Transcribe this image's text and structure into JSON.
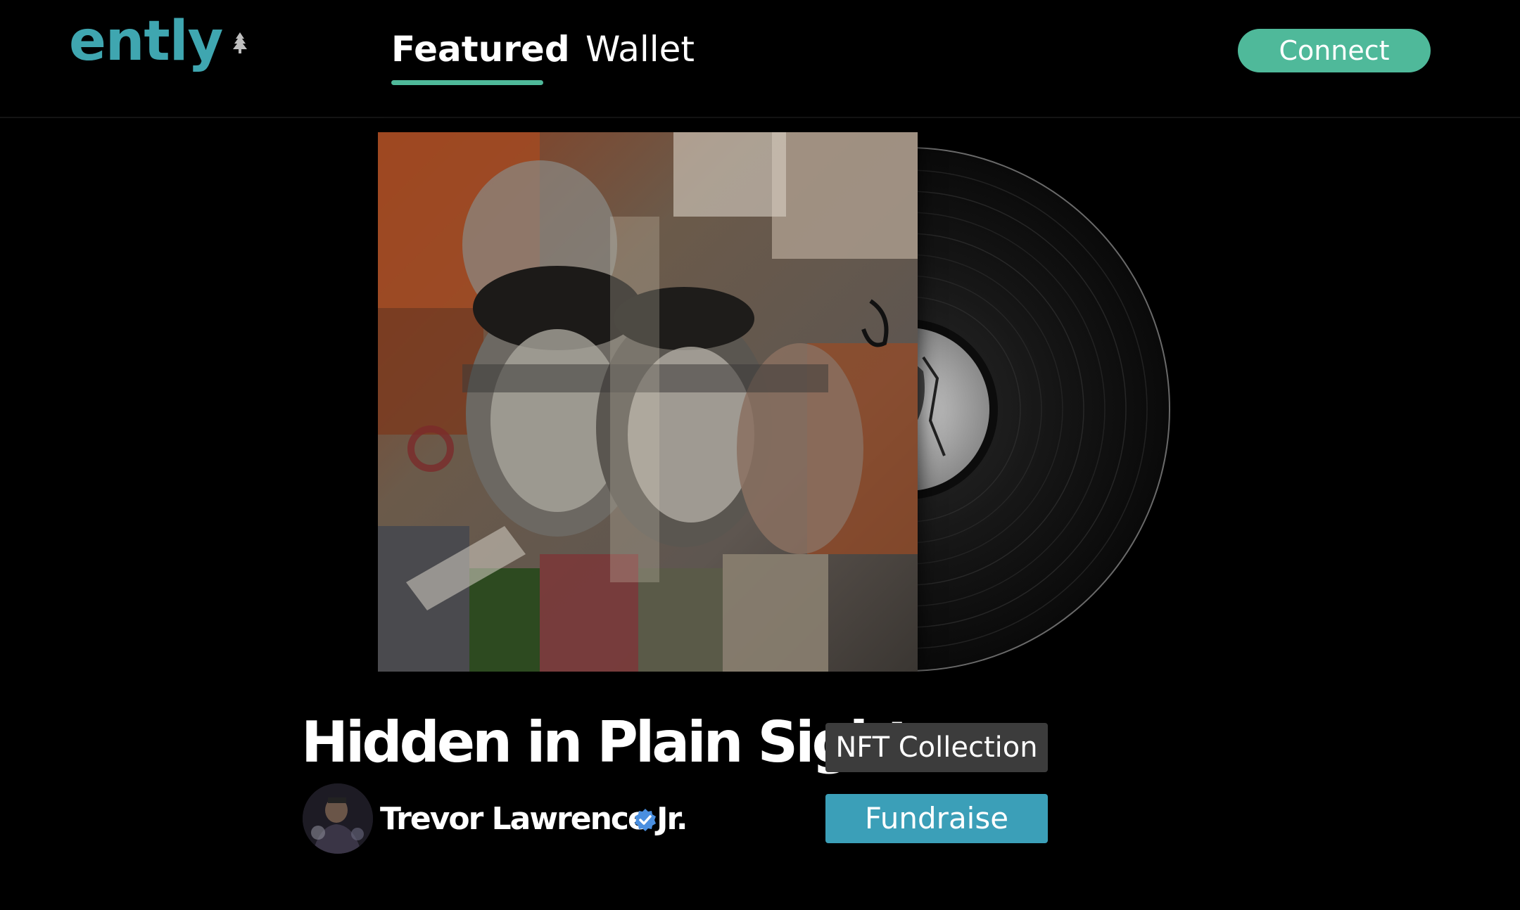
{
  "header": {
    "logo_text": "ently",
    "tabs": [
      {
        "label": "Featured",
        "active": true
      },
      {
        "label": "Wallet",
        "active": false
      }
    ],
    "connect_label": "Connect"
  },
  "release": {
    "title": "Hidden in Plain Sight",
    "type_badge": "NFT Collection",
    "artist_name": "Trevor Lawrence Jr.",
    "fundraise_label": "Fundraise"
  },
  "icons": {
    "logo_tree": "tree-icon",
    "verified": "verified-badge-icon"
  },
  "colors": {
    "background": "#000000",
    "accent_green": "#4fb99a",
    "logo_teal": "#3fa6b0",
    "fundraise_blue": "#3b9fb8",
    "badge_gray": "#3c3c3c",
    "verified_blue": "#4a8fe0"
  }
}
